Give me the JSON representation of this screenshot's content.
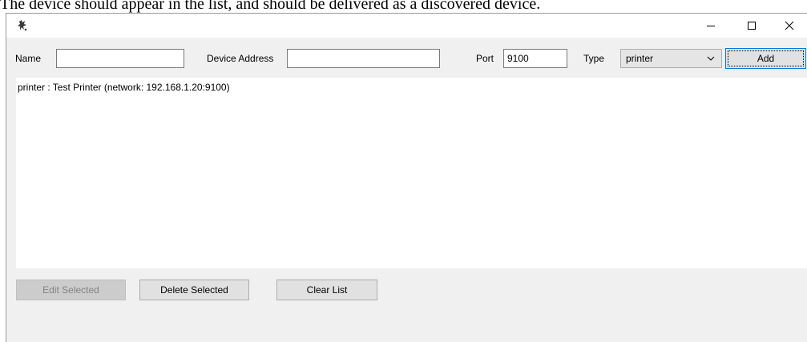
{
  "caption": "The device should appear in the list, and should be delivered as a discovered device.",
  "window": {
    "icon": "app-logo-icon",
    "controls": {
      "minimize": "minimize-icon",
      "maximize": "maximize-icon",
      "close": "close-icon"
    }
  },
  "form": {
    "name_label": "Name",
    "name_value": "",
    "address_label": "Device Address",
    "address_value": "",
    "port_label": "Port",
    "port_value": "9100",
    "type_label": "Type",
    "type_selected": "printer",
    "add_label": "Add"
  },
  "devices": [
    "printer : Test Printer (network: 192.168.1.20:9100)"
  ],
  "actions": {
    "edit_label": "Edit Selected",
    "delete_label": "Delete Selected",
    "clear_label": "Clear List"
  }
}
